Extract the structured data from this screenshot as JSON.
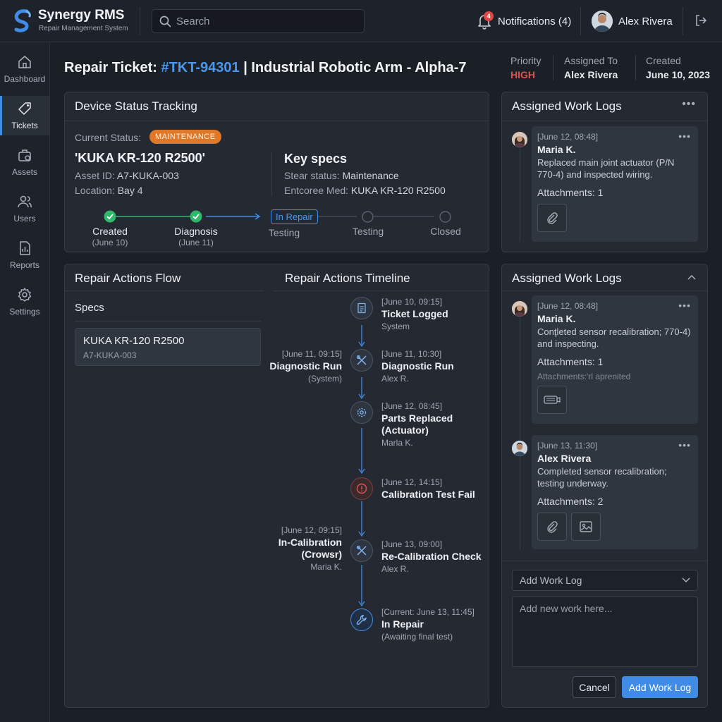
{
  "brand": {
    "name": "Synergy RMS",
    "subtitle": "Repair Management System"
  },
  "search": {
    "placeholder": "Search"
  },
  "notifications": {
    "label": "Notifications (4)",
    "count": "4"
  },
  "user": {
    "name": "Alex Rivera"
  },
  "nav": [
    {
      "label": "Dashboard",
      "icon": "home-icon"
    },
    {
      "label": "Tickets",
      "icon": "tag-icon",
      "active": true
    },
    {
      "label": "Assets",
      "icon": "briefcase-icon"
    },
    {
      "label": "Users",
      "icon": "users-icon"
    },
    {
      "label": "Reports",
      "icon": "report-icon"
    },
    {
      "label": "Settings",
      "icon": "gear-icon"
    }
  ],
  "ticket": {
    "title_prefix": "Repair Ticket: ",
    "id": "#TKT-94301",
    "title_suffix": " | Industrial Robotic Arm - Alpha-7",
    "priority_label": "Priority",
    "priority": "HIGH",
    "assigned_label": "Assigned To",
    "assigned": "Alex Rivera",
    "created_label": "Created",
    "created": "June 10, 2023"
  },
  "status_panel": {
    "title": "Device Status Tracking",
    "current_status_label": "Current Status:",
    "current_status": "MAINTENANCE",
    "asset_name": "'KUKA KR-120 R2500'",
    "asset_id_label": "Asset ID:",
    "asset_id": "A7-KUKA-003",
    "location_label": "Location:",
    "location": "Bay 4",
    "key_specs_title": "Key specs",
    "spec1_label": "Stear status:",
    "spec1_value": "Maintenance",
    "spec2_label": "Entcoree Med:",
    "spec2_value": "KUKA KR-120 R2500",
    "steps": {
      "created": "Created",
      "created_date": "(June 10)",
      "diagnosis": "Diagnosis",
      "diagnosis_date": "(June 11)",
      "current_pill": "In Repair",
      "current_sub": "Testing",
      "testing": "Testing",
      "closed": "Closed"
    }
  },
  "actions_panel": {
    "flow_title": "Repair Actions Flow",
    "timeline_title": "Repair Actions Timeline",
    "specs_label": "Specs",
    "spec_card_name": "KUKA KR-120 R2500",
    "spec_card_id": "A7-KUKA-003",
    "timeline": [
      {
        "time": "[June 10, 09:15]",
        "title": "Ticket Logged",
        "sub": "System",
        "icon": "document-icon"
      },
      {
        "time": "[June 11, 10:30]",
        "title": "Diagnostic Run",
        "sub": "Alex R.",
        "icon": "tools-icon",
        "left": {
          "time": "[June 11, 09:15]",
          "title": "Diagnostic Run",
          "sub": "(System)"
        }
      },
      {
        "time": "[June 12, 08:45]",
        "title": "Parts Replaced",
        "title2": "(Actuator)",
        "sub": "Marla K.",
        "icon": "gear-icon"
      },
      {
        "time": "[June 12, 14:15]",
        "title": "Calibration Test Fail",
        "icon": "alert-icon"
      },
      {
        "time": "[June 13, 09:00]",
        "title": "Re-Calibration Check",
        "sub": "Alex R.",
        "icon": "tools-icon",
        "left": {
          "time": "[June 12, 09:15]",
          "title": "In-Calibration",
          "title2": "(Crowsr)",
          "sub": "Maria K."
        }
      },
      {
        "time": "[Current: June 13, 11:45]",
        "title": "In Repair",
        "sub": "(Awaiting final test)",
        "icon": "wrench-icon"
      }
    ]
  },
  "logs1": {
    "title": "Assigned Work Logs",
    "entries": [
      {
        "time": "[June 12, 08:48]",
        "author": "Maria K.",
        "text": "Replaced main joint actuator (P/N 770-4) and inspected wiring.",
        "attachments": "Attachments: 1"
      }
    ]
  },
  "logs2": {
    "title": "Assigned Work Logs",
    "entries": [
      {
        "time": "[June 12, 08:48]",
        "author": "Maria K.",
        "text": "Conţleted sensor recalibration; 770-4) and inspecting.",
        "attachments": "Attachments: 1",
        "note": "Attachments:'rl aprenited"
      },
      {
        "time": "[June 13, 11:30]",
        "author": "Alex Rivera",
        "text": "Completed sensor recalibration; testing underway.",
        "attachments": "Attachments: 2"
      }
    ],
    "select_value": "Add Work Log",
    "textarea_placeholder": "Add new work here...",
    "cancel": "Cancel",
    "submit": "Add Work Log"
  },
  "colors": {
    "accent": "#3f8be6",
    "success": "#2fb86a",
    "warning": "#e0782a",
    "danger": "#e05252"
  }
}
